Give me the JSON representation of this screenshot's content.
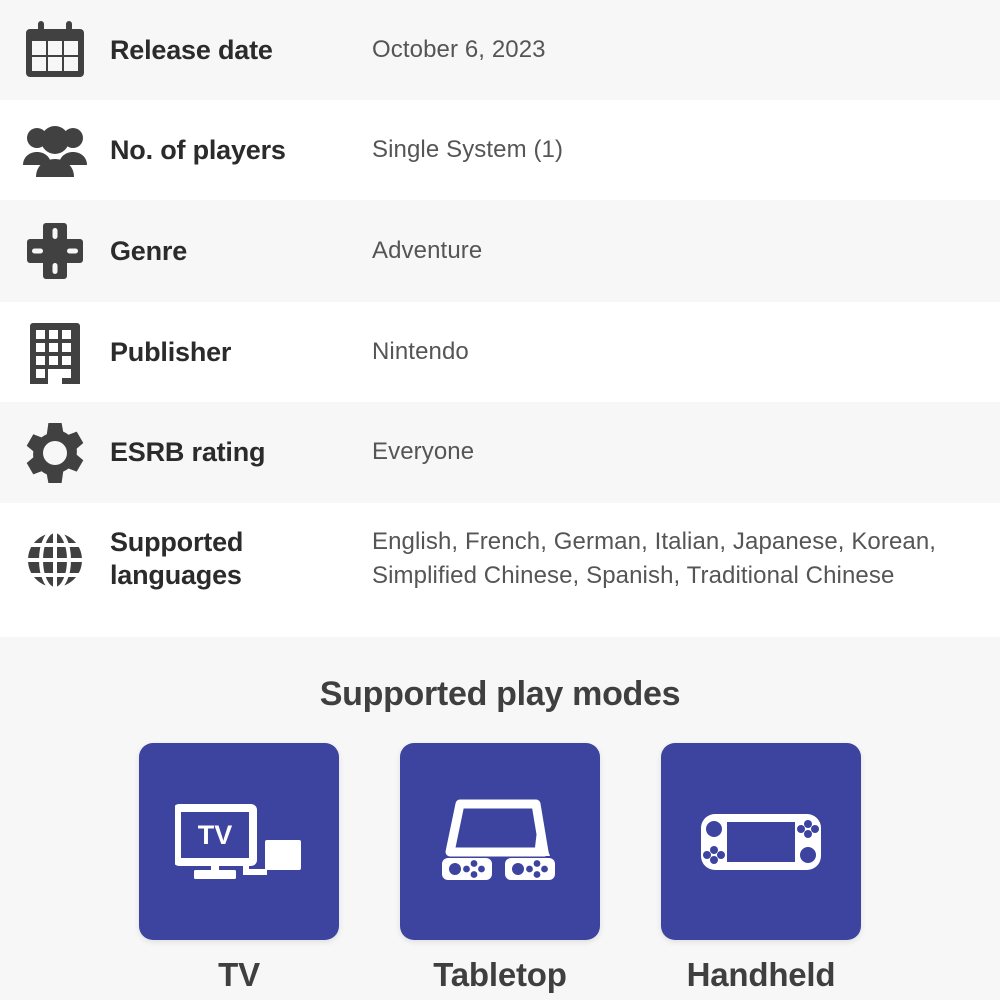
{
  "spec_table": {
    "rows": [
      {
        "icon": "calendar-icon",
        "label": "Release date",
        "value": "October 6, 2023"
      },
      {
        "icon": "players-group-icon",
        "label": "No. of players",
        "value": "Single System (1)"
      },
      {
        "icon": "dpad-icon",
        "label": "Genre",
        "value": "Adventure"
      },
      {
        "icon": "building-icon",
        "label": "Publisher",
        "value": "Nintendo"
      },
      {
        "icon": "gear-icon",
        "label": "ESRB rating",
        "value": "Everyone"
      },
      {
        "icon": "globe-icon",
        "label": "Supported languages",
        "value": "English, French, German, Italian, Japanese, Korean, Simplified Chinese, Spanish, Traditional Chinese"
      }
    ]
  },
  "play_modes": {
    "title": "Supported play modes",
    "tile_color": "#3c44a0",
    "modes": [
      {
        "icon": "tv-mode-icon",
        "label": "TV",
        "screen_text": "TV"
      },
      {
        "icon": "tabletop-mode-icon",
        "label": "Tabletop"
      },
      {
        "icon": "handheld-mode-icon",
        "label": "Handheld"
      }
    ]
  },
  "colors": {
    "row_alt_background": "#f7f7f7",
    "row_background": "#ffffff",
    "label_text": "#2b2b2b",
    "value_text": "#555555",
    "icon_fill": "#414141"
  }
}
